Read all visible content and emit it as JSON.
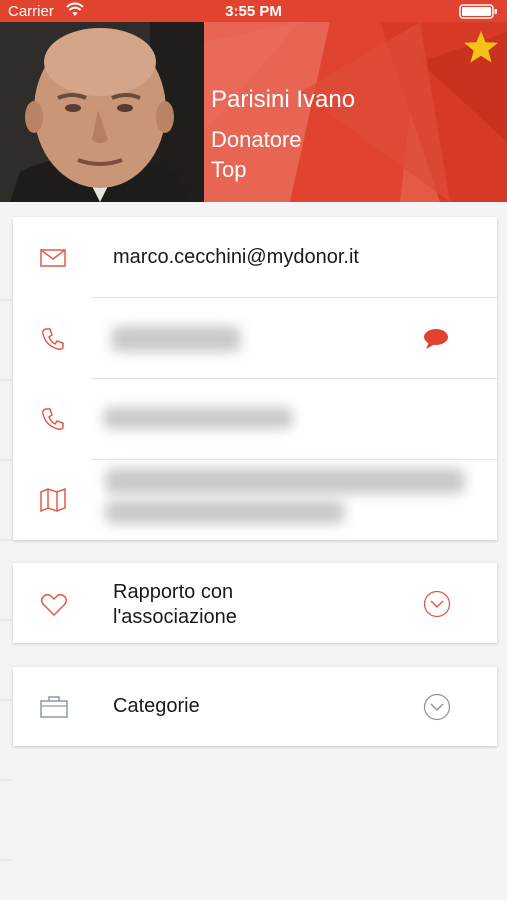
{
  "status_bar": {
    "carrier": "Carrier",
    "time": "3:55 PM"
  },
  "header": {
    "name": "Parisini Ivano",
    "role_line1": "Donatore",
    "role_line2": "Top",
    "accent_color": "#e2432f",
    "star_color": "#f4c318"
  },
  "contacts": {
    "email": "marco.cecchini@mydonor.it"
  },
  "sections": {
    "relation_label": "Rapporto con l'associazione",
    "relation_line1": "Rapporto con",
    "relation_line2": "l'associazione",
    "categories_label": "Categorie"
  },
  "icons": [
    "mail-icon",
    "phone-icon",
    "chat-bubble-icon",
    "map-icon",
    "heart-icon",
    "briefcase-icon",
    "chevron-down-icon",
    "star-icon",
    "wifi-icon",
    "battery-icon"
  ]
}
